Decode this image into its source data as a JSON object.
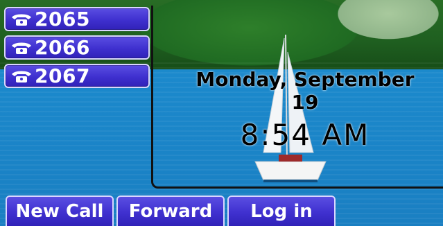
{
  "line_keys": [
    {
      "extension": "2065",
      "icon": "phone-icon"
    },
    {
      "extension": "2066",
      "icon": "phone-icon"
    },
    {
      "extension": "2067",
      "icon": "phone-icon"
    }
  ],
  "idle": {
    "date": "Monday, September 19",
    "time": "8:54 AM"
  },
  "softkeys": {
    "new_call": "New Call",
    "forward": "Forward",
    "log_in": "Log in"
  },
  "colors": {
    "key_fill": "#3f30cf",
    "key_border": "#d9d6ff",
    "water": "#1b88cb"
  }
}
